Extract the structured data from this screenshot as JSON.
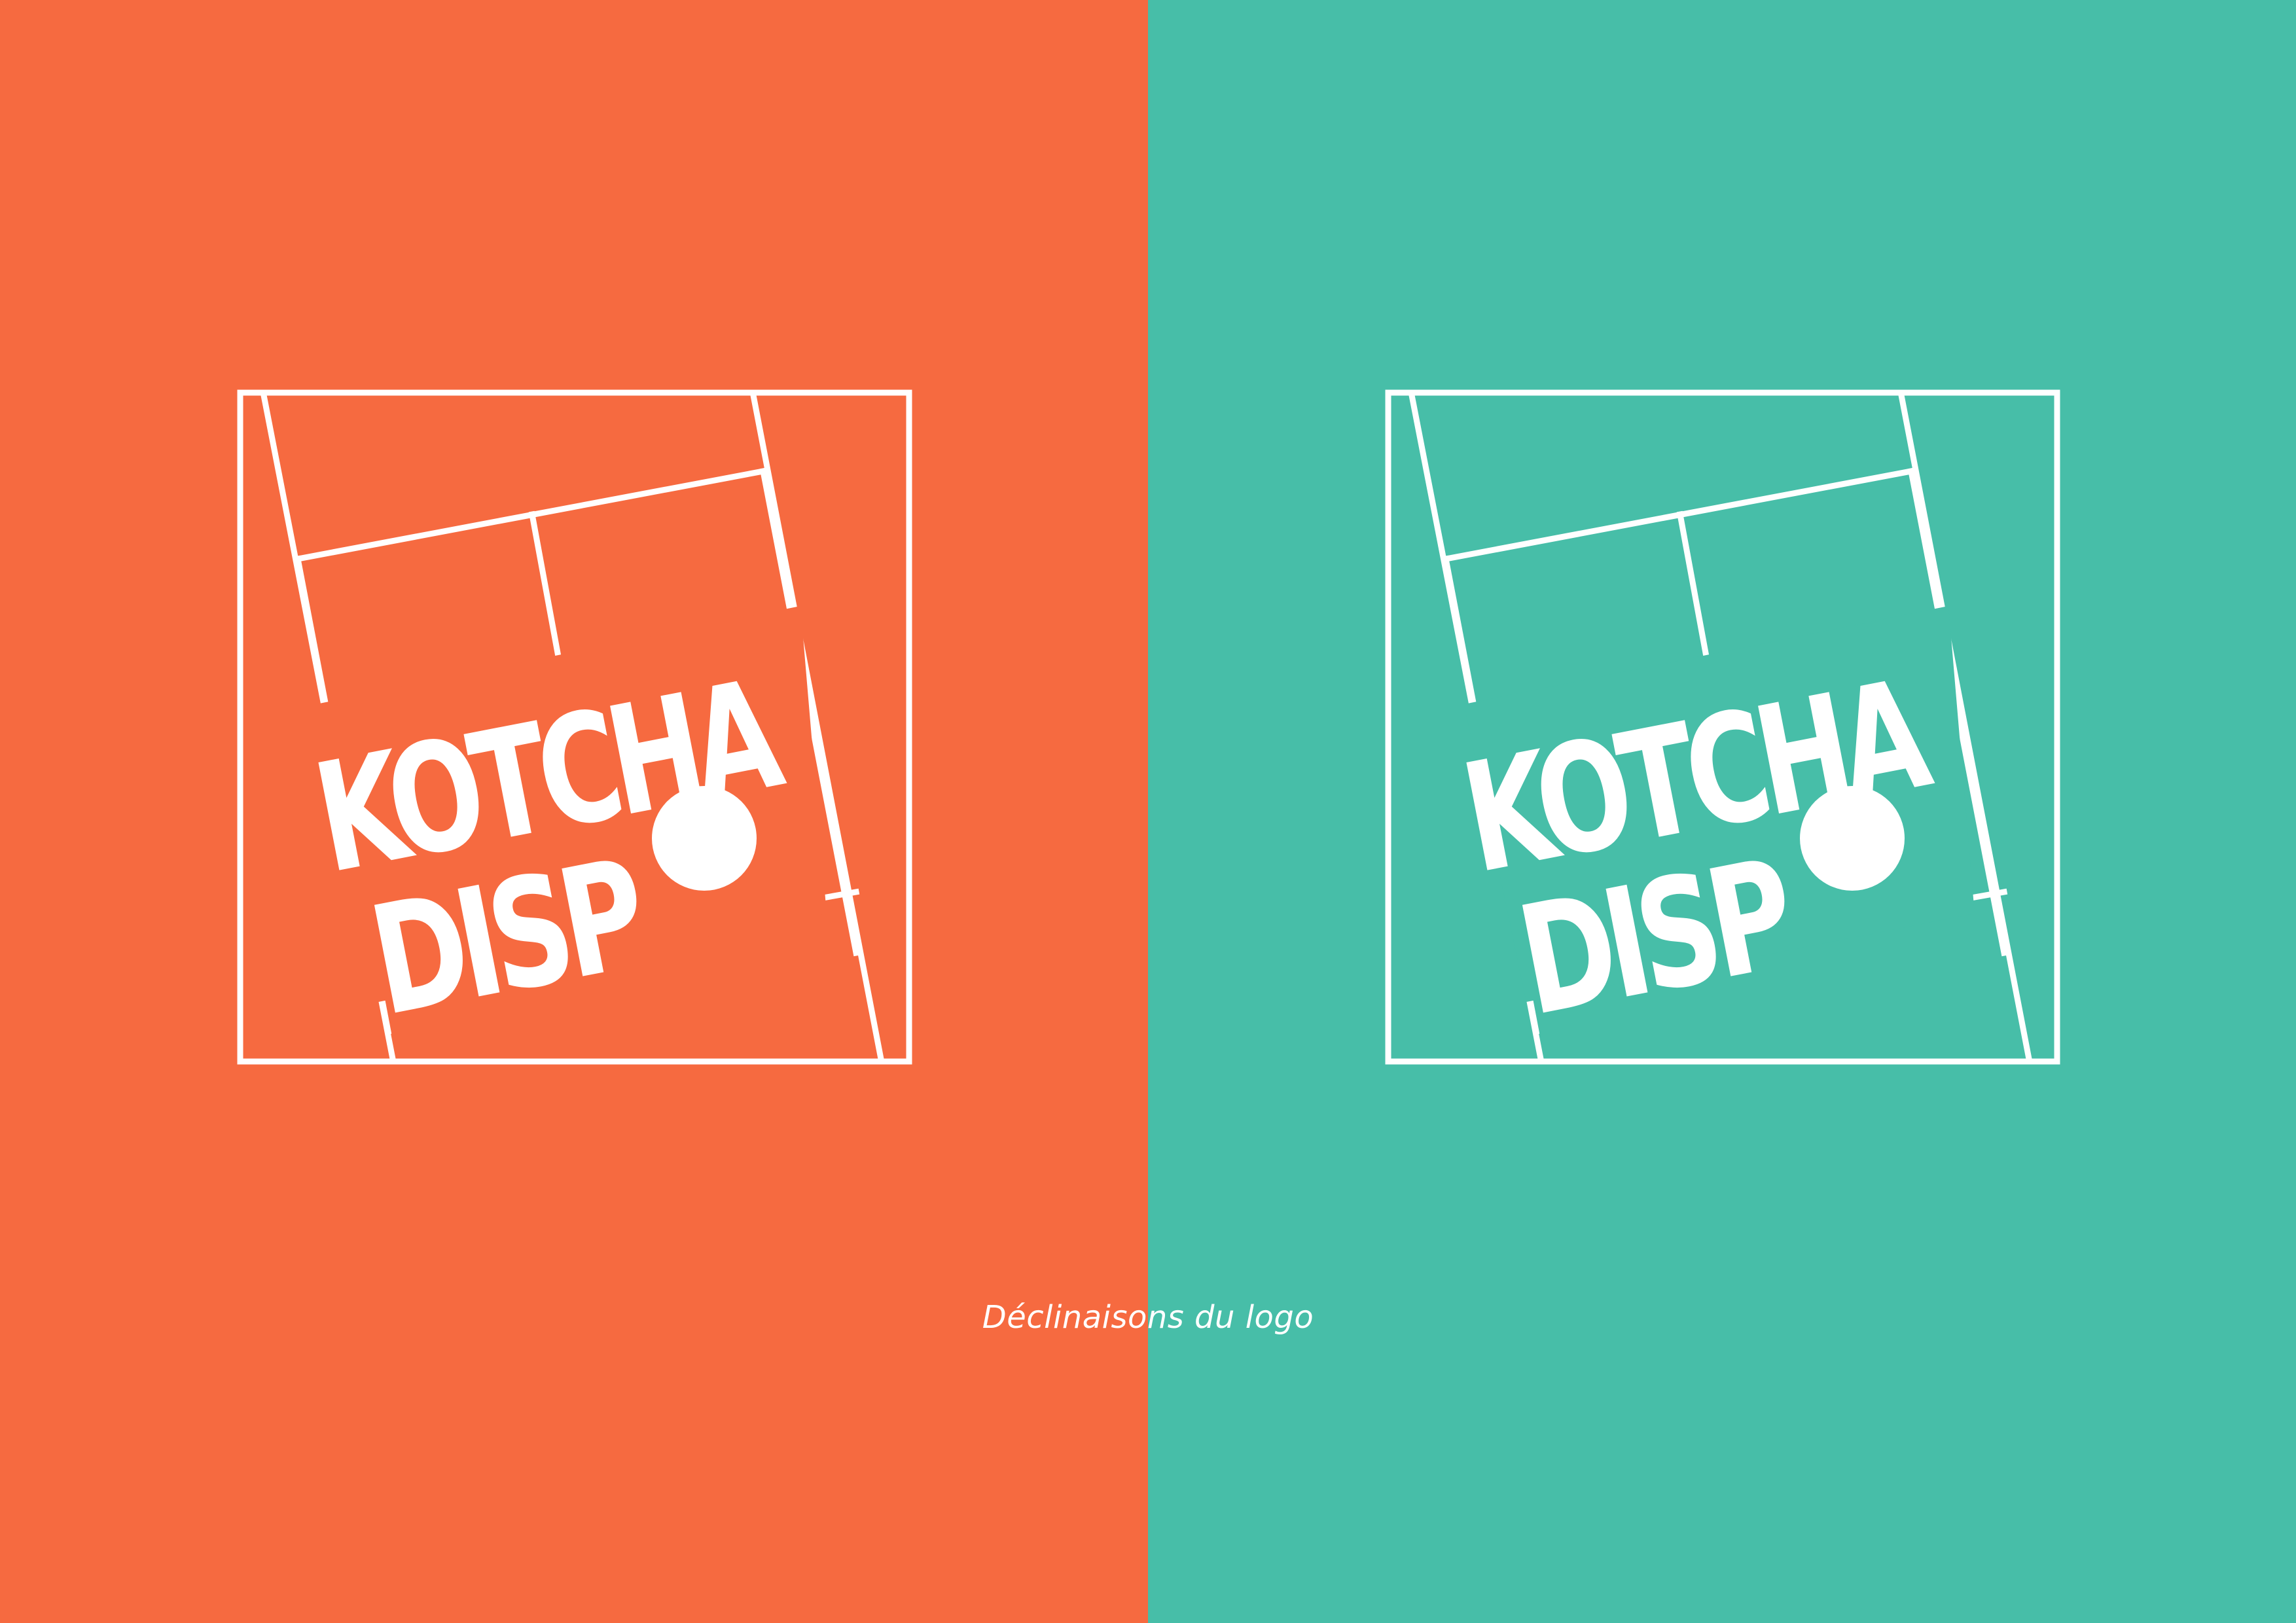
{
  "colors": {
    "orange": "#F66A40",
    "teal": "#47BEA8",
    "white": "#FFFFFF"
  },
  "logos": [
    {
      "variant": "orange",
      "wordmark_line1": "KOTCHA",
      "wordmark_line2": "DISP",
      "ball": "ball-icon"
    },
    {
      "variant": "teal",
      "wordmark_line1": "KOTCHA",
      "wordmark_line2": "DISP",
      "ball": "ball-icon"
    }
  ],
  "caption": "Déclinaisons du logo"
}
